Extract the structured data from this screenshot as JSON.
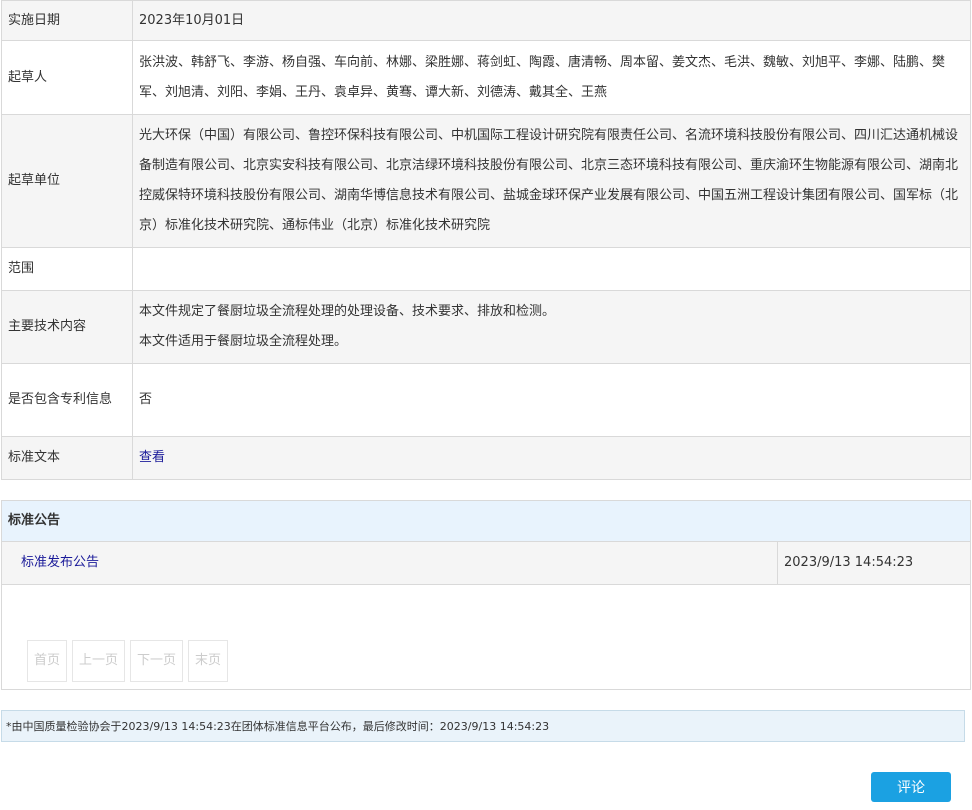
{
  "info": {
    "implement_date": {
      "label": "实施日期",
      "value": "2023年10月01日"
    },
    "drafters": {
      "label": "起草人",
      "value": "张洪波、韩舒飞、李游、杨自强、车向前、林娜、梁胜娜、蒋剑虹、陶霞、唐清畅、周本留、姜文杰、毛洪、魏敏、刘旭平、李娜、陆鹏、樊军、刘旭清、刘阳、李娟、王丹、袁卓异、黄骞、谭大新、刘德涛、戴其全、王燕"
    },
    "drafting_units": {
      "label": "起草单位",
      "value": "光大环保（中国）有限公司、鲁控环保科技有限公司、中机国际工程设计研究院有限责任公司、名流环境科技股份有限公司、四川汇达通机械设备制造有限公司、北京实安科技有限公司、北京洁绿环境科技股份有限公司、北京三态环境科技有限公司、重庆渝环生物能源有限公司、湖南北控威保特环境科技股份有限公司、湖南华博信息技术有限公司、盐城金球环保产业发展有限公司、中国五洲工程设计集团有限公司、国军标（北京）标准化技术研究院、通标伟业（北京）标准化技术研究院"
    },
    "scope": {
      "label": "范围",
      "value": ""
    },
    "main_content": {
      "label": "主要技术内容",
      "line1": "本文件规定了餐厨垃圾全流程处理的处理设备、技术要求、排放和检测。",
      "line2": "本文件适用于餐厨垃圾全流程处理。"
    },
    "patent": {
      "label": "是否包含专利信息",
      "value": "否"
    },
    "standard_text": {
      "label": "标准文本",
      "link": "查看"
    }
  },
  "notice": {
    "header": "标准公告",
    "items": [
      {
        "title": "标准发布公告",
        "time": "2023/9/13 14:54:23"
      }
    ],
    "pager": {
      "first": "首页",
      "prev": "上一页",
      "next": "下一页",
      "last": "末页"
    }
  },
  "publish_info": "*由中国质量检验协会于2023/9/13 14:54:23在团体标准信息平台公布，最后修改时间：2023/9/13 14:54:23",
  "comment_button": "评论",
  "colors": {
    "accent": "#1ba1e2",
    "link": "#1a1a99",
    "header_bg": "#e8f3fd"
  }
}
